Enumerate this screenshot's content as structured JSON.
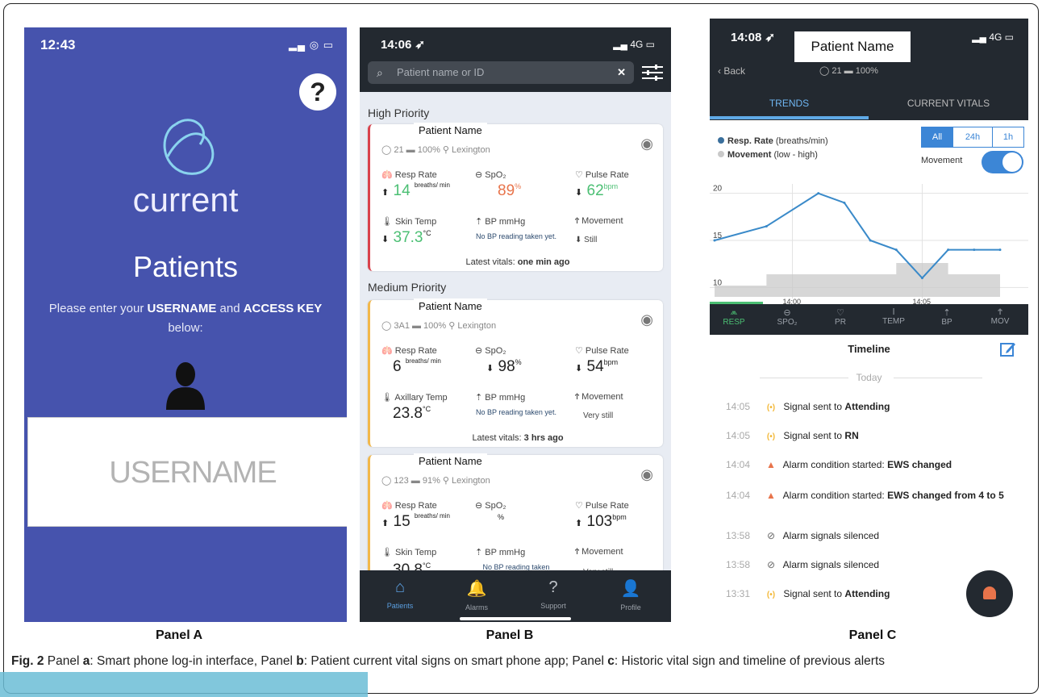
{
  "panel_a": {
    "time": "12:43",
    "status_icons": "▂▄ ◎ ▭",
    "help": "?",
    "brand": "current",
    "title": "Patients",
    "instruction_pre": "Please enter your ",
    "username_word": "USERNAME",
    "and": " and ",
    "access_word": "ACCESS KEY",
    "below": "below:",
    "username_placeholder": "USERNAME"
  },
  "panel_b": {
    "time": "14:06 ➶",
    "status": "▂▄ 4G ▭",
    "search_placeholder": "Patient name or ID",
    "search_clear": "✕",
    "high_priority": "High Priority",
    "medium_priority": "Medium Priority",
    "cards": [
      {
        "name": "Patient Name",
        "meta": "◯ 21  ▬ 100%  ⚲ Lexington",
        "resp_label": "Resp Rate",
        "resp": "14",
        "resp_unit": "breaths/ min",
        "resp_arrow": "⬆",
        "spo2_label": "SpO₂",
        "spo2": "89",
        "spo2_unit": "%",
        "pulse_label": "Pulse Rate",
        "pulse": "62",
        "pulse_unit": "bpm",
        "pulse_arrow": "⬇",
        "temp_label": "Skin Temp",
        "temp": "37.3",
        "temp_unit": "°C",
        "temp_arrow": "⬇",
        "bp_label": "BP mmHg",
        "bp_text": "No BP reading taken yet.",
        "mov_label": "Movement",
        "mov": "Still",
        "mov_arrow": "⬇",
        "latest_pre": "Latest vitals: ",
        "latest": "one min ago"
      },
      {
        "name": "Patient Name",
        "meta": "◯ 3A1  ▬ 100%  ⚲ Lexington",
        "resp_label": "Resp Rate",
        "resp": "6",
        "resp_unit": "breaths/ min",
        "spo2_label": "SpO₂",
        "spo2": "98",
        "spo2_unit": "%",
        "spo2_arrow": "⬇",
        "pulse_label": "Pulse Rate",
        "pulse": "54",
        "pulse_unit": "bpm",
        "pulse_arrow": "⬇",
        "temp_label": "Axillary Temp",
        "temp": "23.8",
        "temp_unit": "°C",
        "bp_label": "BP mmHg",
        "bp_text": "No BP reading taken yet.",
        "mov_label": "Movement",
        "mov": "Very still",
        "latest_pre": "Latest vitals: ",
        "latest": "3 hrs ago"
      },
      {
        "name": "Patient Name",
        "meta": "◯ 123  ▬ 91%  ⚲ Lexington",
        "resp_label": "Resp Rate",
        "resp": "15",
        "resp_unit": "breaths/ min",
        "resp_arrow": "⬆",
        "spo2_label": "SpO₂",
        "spo2_unit": "%",
        "pulse_label": "Pulse Rate",
        "pulse": "103",
        "pulse_unit": "bpm",
        "pulse_arrow": "⬆",
        "temp_label": "Skin Temp",
        "temp": "30.8",
        "temp_unit": "°C",
        "bp_label": "BP mmHg",
        "bp_text": "No BP reading taken",
        "mov_label": "Movement",
        "mov": "Very still"
      }
    ],
    "tabs": [
      "Patients",
      "Alarms",
      "Support",
      "Profile"
    ]
  },
  "panel_c": {
    "time": "14:08 ➶",
    "status": "▂▄ 4G ▭",
    "patient_name": "Patient Name",
    "back": "‹ Back",
    "meta": "◯ 21  ▬ 100%",
    "tab_trends": "TRENDS",
    "tab_current": "CURRENT VITALS",
    "legend_resp_b": "Resp. Rate",
    "legend_resp": " (breaths/min)",
    "legend_mov_b": "Movement",
    "legend_mov": " (low - high)",
    "range_all": "All",
    "range_24h": "24h",
    "range_1h": "1h",
    "movement_toggle": "Movement",
    "vital_tabs": [
      "RESP",
      "SPO₂",
      "PR",
      "TEMP",
      "BP",
      "MOV"
    ],
    "timeline_title": "Timeline",
    "today": "Today",
    "events": [
      {
        "time": "14:05",
        "icon": "signal-icon",
        "text_pre": "Signal sent to ",
        "text_b": "Attending"
      },
      {
        "time": "14:05",
        "icon": "signal-icon",
        "text_pre": "Signal sent to ",
        "text_b": "RN"
      },
      {
        "time": "14:04",
        "icon": "alarm-icon",
        "text_pre": "Alarm condition started: ",
        "text_b": "EWS changed"
      },
      {
        "time": "14:04",
        "icon": "alarm-icon",
        "text_pre": "Alarm condition started: ",
        "text_b": "EWS changed from 4 to 5"
      },
      {
        "time": "13:58",
        "icon": "silence-icon",
        "text_pre": "Alarm signals silenced",
        "text_b": ""
      },
      {
        "time": "13:58",
        "icon": "silence-icon",
        "text_pre": "Alarm signals silenced",
        "text_b": ""
      },
      {
        "time": "13:31",
        "icon": "signal-icon",
        "text_pre": "Signal sent to ",
        "text_b": "Attending"
      }
    ]
  },
  "chart_data": {
    "type": "line",
    "x_ticks": [
      "14:00",
      "14:05"
    ],
    "y_ticks": [
      "20",
      "15",
      "10"
    ],
    "ylim": [
      9,
      21
    ],
    "x": [
      "13:57",
      "13:59",
      "14:01",
      "14:02",
      "14:03",
      "14:04",
      "14:05",
      "14:06",
      "14:07",
      "14:08"
    ],
    "series": [
      {
        "name": "Resp. Rate",
        "values": [
          15,
          16.5,
          20,
          19,
          15,
          14,
          11,
          14,
          14,
          14
        ],
        "color": "#3a8ac9"
      },
      {
        "name": "Movement",
        "values": [
          1,
          2,
          2,
          2,
          2,
          3,
          3,
          2,
          2,
          2
        ],
        "color": "#c9c9c9"
      }
    ]
  },
  "labels": {
    "panel_a": "Panel A",
    "panel_b": "Panel B",
    "panel_c": "Panel C"
  },
  "caption": {
    "fig": "Fig. 2",
    "p1": " Panel ",
    "a": "a",
    "p2": ": Smart phone log-in interface, Panel ",
    "b": "b",
    "p3": ": Patient current vital signs on smart phone app; Panel ",
    "c": "c",
    "p4": ": Historic vital sign and timeline of previous alerts"
  }
}
